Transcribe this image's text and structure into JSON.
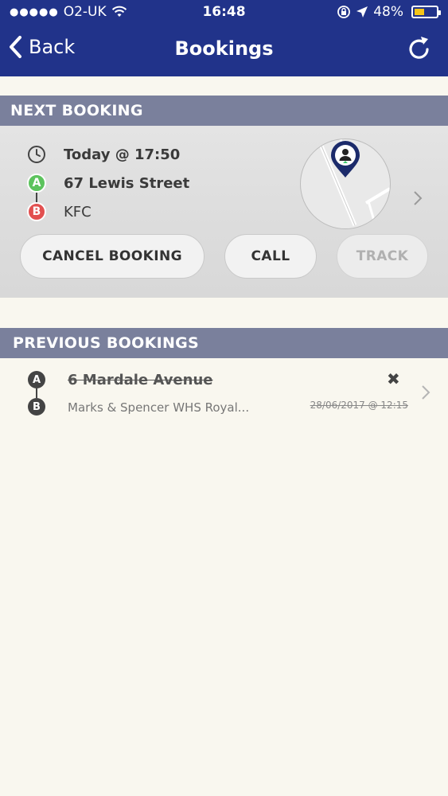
{
  "status_bar": {
    "carrier": "O2-UK",
    "time": "16:48",
    "battery": "48%",
    "battery_level": 0.48
  },
  "nav": {
    "back_label": "Back",
    "title": "Bookings",
    "refresh_icon": "refresh-icon"
  },
  "next_booking": {
    "header": "NEXT BOOKING",
    "time": "Today @ 17:50",
    "pickup": "67 Lewis Street",
    "dropoff": "KFC",
    "marker_a": "A",
    "marker_b": "B",
    "buttons": {
      "cancel": "CANCEL BOOKING",
      "call": "CALL",
      "track": "TRACK"
    }
  },
  "previous_bookings": {
    "header": "PREVIOUS BOOKINGS",
    "items": [
      {
        "from": "6 Mardale Avenue",
        "to": "Marks & Spencer WHS Royal...",
        "date": "28/06/2017 @ 12:15",
        "marker_a": "A",
        "marker_b": "B"
      }
    ]
  },
  "colors": {
    "header_bg": "#21338a",
    "section_bg": "#7a809c",
    "marker_a": "#5cc35d",
    "marker_b": "#e25050",
    "page_bg": "#f9f7ef"
  }
}
